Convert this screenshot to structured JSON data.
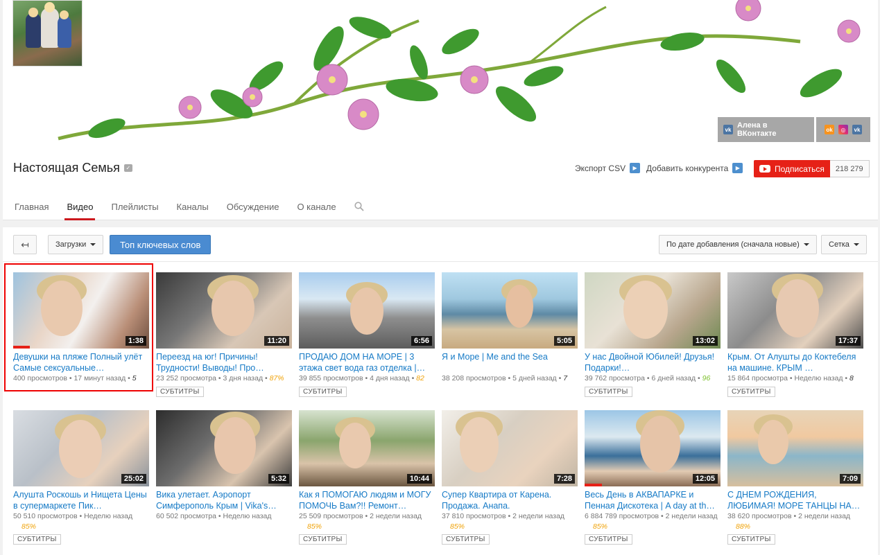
{
  "banner": {
    "social_vk_label": "Алена в ВКонтакте",
    "social_icons": [
      "odnoklassniki-icon",
      "instagram-icon",
      "vk-icon"
    ]
  },
  "header": {
    "channel_title": "Настоящая Семья",
    "export_csv": "Экспорт CSV",
    "add_competitor": "Добавить конкурента",
    "subscribe_label": "Подписаться",
    "subscriber_count": "218 279",
    "tabs": [
      "Главная",
      "Видео",
      "Плейлисты",
      "Каналы",
      "Обсуждение",
      "О канале"
    ],
    "active_tab": "Видео"
  },
  "toolbar": {
    "back": "↤",
    "uploads_label": "Загрузки",
    "keywords_label": "Топ ключевых слов",
    "sort_label": "По дате добавления (сначала новые)",
    "view_label": "Сетка"
  },
  "colors": {
    "accent_red": "#e62117",
    "link_blue": "#167ac6",
    "keyword_blue": "#4a8bd1"
  },
  "videos": [
    {
      "title": "Девушки на пляже Полный улёт Самые сексуальные…",
      "views": "400 просмотров",
      "age": "17 минут назад",
      "pct": "5",
      "duration": "1:38",
      "subtitles": "",
      "progress": 0.12
    },
    {
      "title": "Переезд на юг! Причины! Трудности! Выводы! Про…",
      "views": "23 252 просмотра",
      "age": "3 дня назад",
      "pct": "87%",
      "duration": "11:20",
      "subtitles": "СУБТИТРЫ",
      "progress": 0
    },
    {
      "title": "ПРОДАЮ ДОМ НА МОРЕ | 3 этажа свет вода газ отделка |…",
      "views": "39 855 просмотров",
      "age": "4 дня назад",
      "pct": "82",
      "duration": "6:56",
      "subtitles": "СУБТИТРЫ",
      "progress": 0
    },
    {
      "title": "Я и Море | Me and the Sea",
      "views": "38 208 просмотров",
      "age": "5 дней назад",
      "pct": "7",
      "duration": "5:05",
      "subtitles": "",
      "progress": 0
    },
    {
      "title": "У нас Двойной Юбилей! Друзья! Подарки!…",
      "views": "39 762 просмотра",
      "age": "6 дней назад",
      "pct": "96",
      "duration": "13:02",
      "subtitles": "СУБТИТРЫ",
      "progress": 0
    },
    {
      "title": "Крым. От Алушты до Коктебеля на машине. КРЫМ …",
      "views": "15 864 просмотра",
      "age": "Неделю назад",
      "pct": "8",
      "duration": "17:37",
      "subtitles": "СУБТИТРЫ",
      "progress": 0
    },
    {
      "title": "Алушта Роскошь и Нищета Цены в супермаркете Пик…",
      "views": "50 510 просмотров",
      "age": "Неделю назад",
      "pct": "85%",
      "duration": "25:02",
      "subtitles": "СУБТИТРЫ",
      "progress": 0
    },
    {
      "title": "Вика улетает. Аэропорт Симферополь Крым | Vika's…",
      "views": "60 502 просмотра",
      "age": "Неделю назад",
      "pct": "",
      "duration": "5:32",
      "subtitles": "",
      "progress": 0
    },
    {
      "title": "Как я ПОМОГАЮ людям и МОГУ ПОМОЧЬ Вам?!! Ремонт…",
      "views": "25 509 просмотров",
      "age": "2 недели назад",
      "pct": "85%",
      "duration": "10:44",
      "subtitles": "СУБТИТРЫ",
      "progress": 0
    },
    {
      "title": "Супер Квартира от Карена. Продажа. Анапа.",
      "views": "37 810 просмотров",
      "age": "2 недели назад",
      "pct": "85%",
      "duration": "7:28",
      "subtitles": "СУБТИТРЫ",
      "progress": 0
    },
    {
      "title": "Весь День в АКВАПАРКЕ и Пенная Дискотека | A day at th…",
      "views": "6 884 789 просмотров",
      "age": "2 недели назад",
      "pct": "85%",
      "duration": "12:05",
      "subtitles": "СУБТИТРЫ",
      "progress": 0.13
    },
    {
      "title": "С ДНЕМ РОЖДЕНИЯ, ЛЮБИМАЯ! МОРЕ ТАНЦЫ НА…",
      "views": "38 620 просмотров",
      "age": "2 недели назад",
      "pct": "88%",
      "duration": "7:09",
      "subtitles": "СУБТИТРЫ",
      "progress": 0
    }
  ]
}
